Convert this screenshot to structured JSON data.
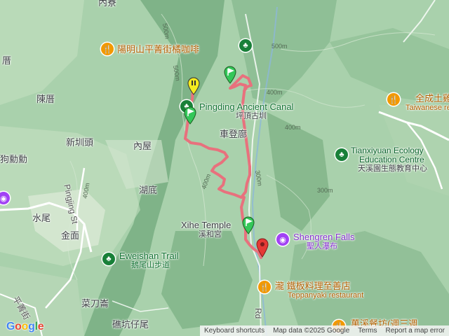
{
  "map": {
    "labels": {
      "neiliao": "內寮",
      "caf": "陽明山平菁街橘咖啡",
      "chenliao": "陳厝",
      "liao": "厝",
      "pingding_en": "Pingding Ancient Canal",
      "pingding_zh": "坪頂古圳",
      "chedengku": "車登廍",
      "jiaxunmu": "狗勳勳",
      "xinzhentou": "新圳頭",
      "neiwu": "內屋",
      "hudi": "湖底",
      "shuiwei": "水尾",
      "jinmian": "金面",
      "caidaoken": "菜刀崙",
      "lukeng": "礁坑仔尾",
      "xihe_en": "Xihe Temple",
      "xihe_zh": "溪和宮",
      "shengren_en": "Shengren Falls",
      "shengren_zh": "聖人瀑布",
      "eweishan_en": "Eweishan Trail",
      "eweishan_zh": "鵝尾山步道",
      "teppan_zh": "瀧 鐵板料理至善店",
      "teppan_en": "Teppanyaki restaurant",
      "tianxiyuan_en1": "Tianxiyuan Ecology",
      "tianxiyuan_en2": "Education Centre",
      "tianxiyuan_zh": "天溪園生態教育中心",
      "quancheng_zh": "全成土雞",
      "quancheng_en": "Taiwanese re",
      "wanxi": "萬溪餐坊(週三週",
      "pingqing_road": "Pingjing St",
      "pingqing_road2": "平菁街",
      "road_rd": "Rd"
    },
    "contours": [
      "500m",
      "500m",
      "400m",
      "400m",
      "400m",
      "300m",
      "300m",
      "400m",
      "500m"
    ],
    "trail_color": "#e8717d",
    "marker_colors": {
      "start": "#f4eb1f",
      "waypoint": "#34c759",
      "end": "#e53935"
    }
  },
  "attribution": {
    "keyboard": "Keyboard shortcuts",
    "mapdata": "Map data ©2025 Google",
    "terms": "Terms",
    "report": "Report a map error"
  },
  "logo": "Google"
}
